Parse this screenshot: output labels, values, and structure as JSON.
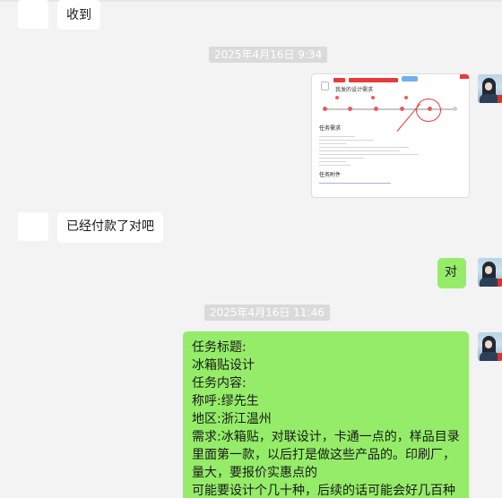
{
  "messages": {
    "m1": {
      "text": "收到"
    },
    "time1": "2025年4月16日 9:34",
    "image_thumb": {
      "title": "我发的设计需求",
      "section1": "任务需求",
      "section2": "任务附件"
    },
    "m2": {
      "text": "已经付款了对吧"
    },
    "m3": {
      "text": "对"
    },
    "time2": "2025年4月16日 11:46",
    "m4": {
      "lines": [
        "任务标题:",
        "冰箱贴设计",
        "任务内容:",
        "称呼:缪先生",
        "地区:浙江温州",
        "需求:冰箱贴，对联设计，卡通一点的，样品目录",
        "里面第一款，以后打是做这些产品的。印刷厂，",
        "量大，要报价实惠点的",
        "可能要设计个几十种，后续的话可能会好几百种"
      ]
    }
  },
  "colors": {
    "background": "#f3f3f3",
    "incoming_bubble": "#ffffff",
    "outgoing_bubble": "#95ec69",
    "timestamp_bg": "#dadada"
  }
}
